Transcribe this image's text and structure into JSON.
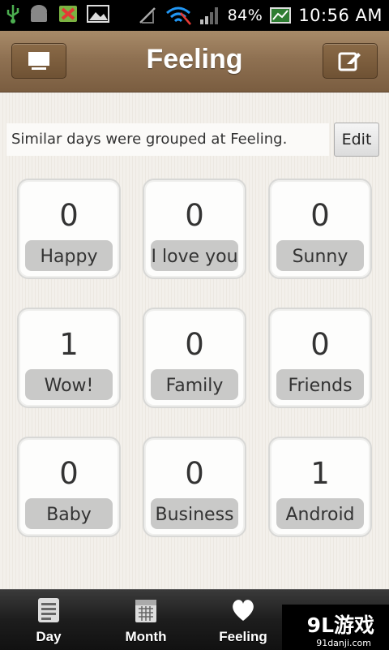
{
  "status_bar": {
    "battery": "84%",
    "time": "10:56 AM",
    "icons": [
      "usb-icon",
      "android-icon",
      "sd-card-error-icon",
      "image-icon",
      "no-signal-icon",
      "wifi-icon",
      "signal-icon",
      "battery-icon",
      "screenshot-icon"
    ]
  },
  "header": {
    "title": "Feeling",
    "left_icon": "monitor-icon",
    "right_icon": "edit-icon"
  },
  "info": {
    "text": "Similar days were grouped at Feeling.",
    "edit_label": "Edit"
  },
  "feelings": [
    {
      "count": "0",
      "label": "Happy"
    },
    {
      "count": "0",
      "label": "I love you"
    },
    {
      "count": "0",
      "label": "Sunny"
    },
    {
      "count": "1",
      "label": "Wow!"
    },
    {
      "count": "0",
      "label": "Family"
    },
    {
      "count": "0",
      "label": "Friends"
    },
    {
      "count": "0",
      "label": "Baby"
    },
    {
      "count": "0",
      "label": "Business"
    },
    {
      "count": "1",
      "label": "Android"
    }
  ],
  "tabs": [
    {
      "label": "Day",
      "icon": "list-icon"
    },
    {
      "label": "Month",
      "icon": "calendar-icon"
    },
    {
      "label": "Feeling",
      "icon": "heart-icon"
    }
  ],
  "watermark": {
    "text": "9L游戏",
    "sub": "91danji.com"
  },
  "colors": {
    "header": "#8f7152",
    "label_bg": "#c9c9c8",
    "tabbar": "#1d1d1d"
  }
}
